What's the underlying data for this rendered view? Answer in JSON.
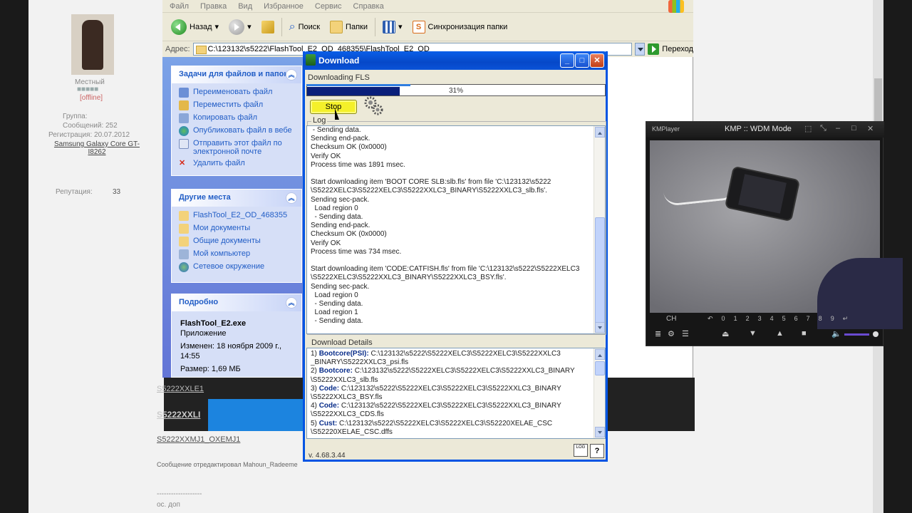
{
  "explorer": {
    "menu": [
      "Файл",
      "Правка",
      "Вид",
      "Избранное",
      "Сервис",
      "Справка"
    ],
    "toolbar": {
      "back": "Назад",
      "search": "Поиск",
      "folders": "Папки",
      "sync": "Синхронизация папки"
    },
    "address_label": "Адрес:",
    "address": "C:\\123132\\s5222\\FlashTool_E2_OD_468355\\FlashTool_E2_OD",
    "go": "Переход",
    "tasks": {
      "title": "Задачи для файлов и папок",
      "items": [
        "Переименовать файл",
        "Переместить файл",
        "Копировать файл",
        "Опубликовать файл в вебе",
        "Отправить этот файл по электронной почте",
        "Удалить файл"
      ]
    },
    "places": {
      "title": "Другие места",
      "items": [
        "FlashTool_E2_OD_468355",
        "Мои документы",
        "Общие документы",
        "Мой компьютер",
        "Сетевое окружение"
      ]
    },
    "details": {
      "title": "Подробно",
      "name": "FlashTool_E2.exe",
      "type": "Приложение",
      "modified": "Изменен: 18 ноября 2009 г., 14:55",
      "size": "Размер: 1,69 МБ"
    }
  },
  "forum": {
    "user_title": "Местный",
    "status": "[offline]",
    "group": "Группа:",
    "posts": "Сообщений: 252",
    "registered": "Регистрация: 20.07.2012",
    "device": "Samsung Galaxy Core GT-I8262",
    "reputation": "Репутация:",
    "rep_value": "33",
    "link1": "S5222XXLE1",
    "link2": "S5222XXLI",
    "link3": "S5222XXMJ1_OXEMJ1",
    "edited": "Сообщение отредактировал Mahoun_Radeeme",
    "dots": "-------------------",
    "footer": "ос. доп"
  },
  "dialog": {
    "title": "Download",
    "status": "Downloading FLS",
    "progress": 0.31,
    "progress_label": "31%",
    "stop": "Stop",
    "log_label": "Log",
    "log": " - Sending data.\nSending end-pack.\nChecksum OK (0x0000)\nVerify OK\nProcess time was 1891 msec.\n\nStart downloading item 'BOOT CORE SLB:slb.fls' from file 'C:\\123132\\s5222\n\\S5222XELC3\\S5222XELC3\\S5222XXLC3_BINARY\\S5222XXLC3_slb.fls'.\nSending sec-pack.\n  Load region 0\n  - Sending data.\nSending end-pack.\nChecksum OK (0x0000)\nVerify OK\nProcess time was 734 msec.\n\nStart downloading item 'CODE:CATFISH.fls' from file 'C:\\123132\\s5222\\S5222XELC3\n\\S5222XELC3\\S5222XXLC3_BINARY\\S5222XXLC3_BSY.fls'.\nSending sec-pack.\n  Load region 0\n  - Sending data.\n  Load region 1\n  - Sending data.",
    "details_label": "Download Details",
    "details": [
      {
        "n": "1)",
        "k": "Bootcore(PSI):",
        "v": "C:\\123132\\s5222\\S5222XELC3\\S5222XELC3\\S5222XXLC3",
        "v2": "_BINARY\\S5222XXLC3_psi.fls"
      },
      {
        "n": "2)",
        "k": "Bootcore:",
        "v": "C:\\123132\\s5222\\S5222XELC3\\S5222XELC3\\S5222XXLC3_BINARY",
        "v2": "\\S5222XXLC3_slb.fls"
      },
      {
        "n": "3)",
        "k": "Code:",
        "v": "C:\\123132\\s5222\\S5222XELC3\\S5222XELC3\\S5222XXLC3_BINARY",
        "v2": "\\S5222XXLC3_BSY.fls"
      },
      {
        "n": "4)",
        "k": "Code:",
        "v": "C:\\123132\\s5222\\S5222XELC3\\S5222XELC3\\S5222XXLC3_BINARY",
        "v2": "\\S5222XXLC3_CDS.fls"
      },
      {
        "n": "5)",
        "k": "Cust:",
        "v": "C:\\123132\\s5222\\S5222XELC3\\S5222XELC3\\S52220XELAE_CSC",
        "v2": "\\S52220XELAE_CSC.dffs"
      }
    ],
    "version": "v. 4.68.3.44",
    "log_btn": "LOG",
    "help_btn": "?"
  },
  "kmp": {
    "brand": "KMPlayer",
    "caption": "KMP :: WDM Mode",
    "ch": "CH",
    "digits": [
      "0",
      "1",
      "2",
      "3",
      "4",
      "5",
      "6",
      "7",
      "8",
      "9"
    ],
    "volume": 0.8
  }
}
